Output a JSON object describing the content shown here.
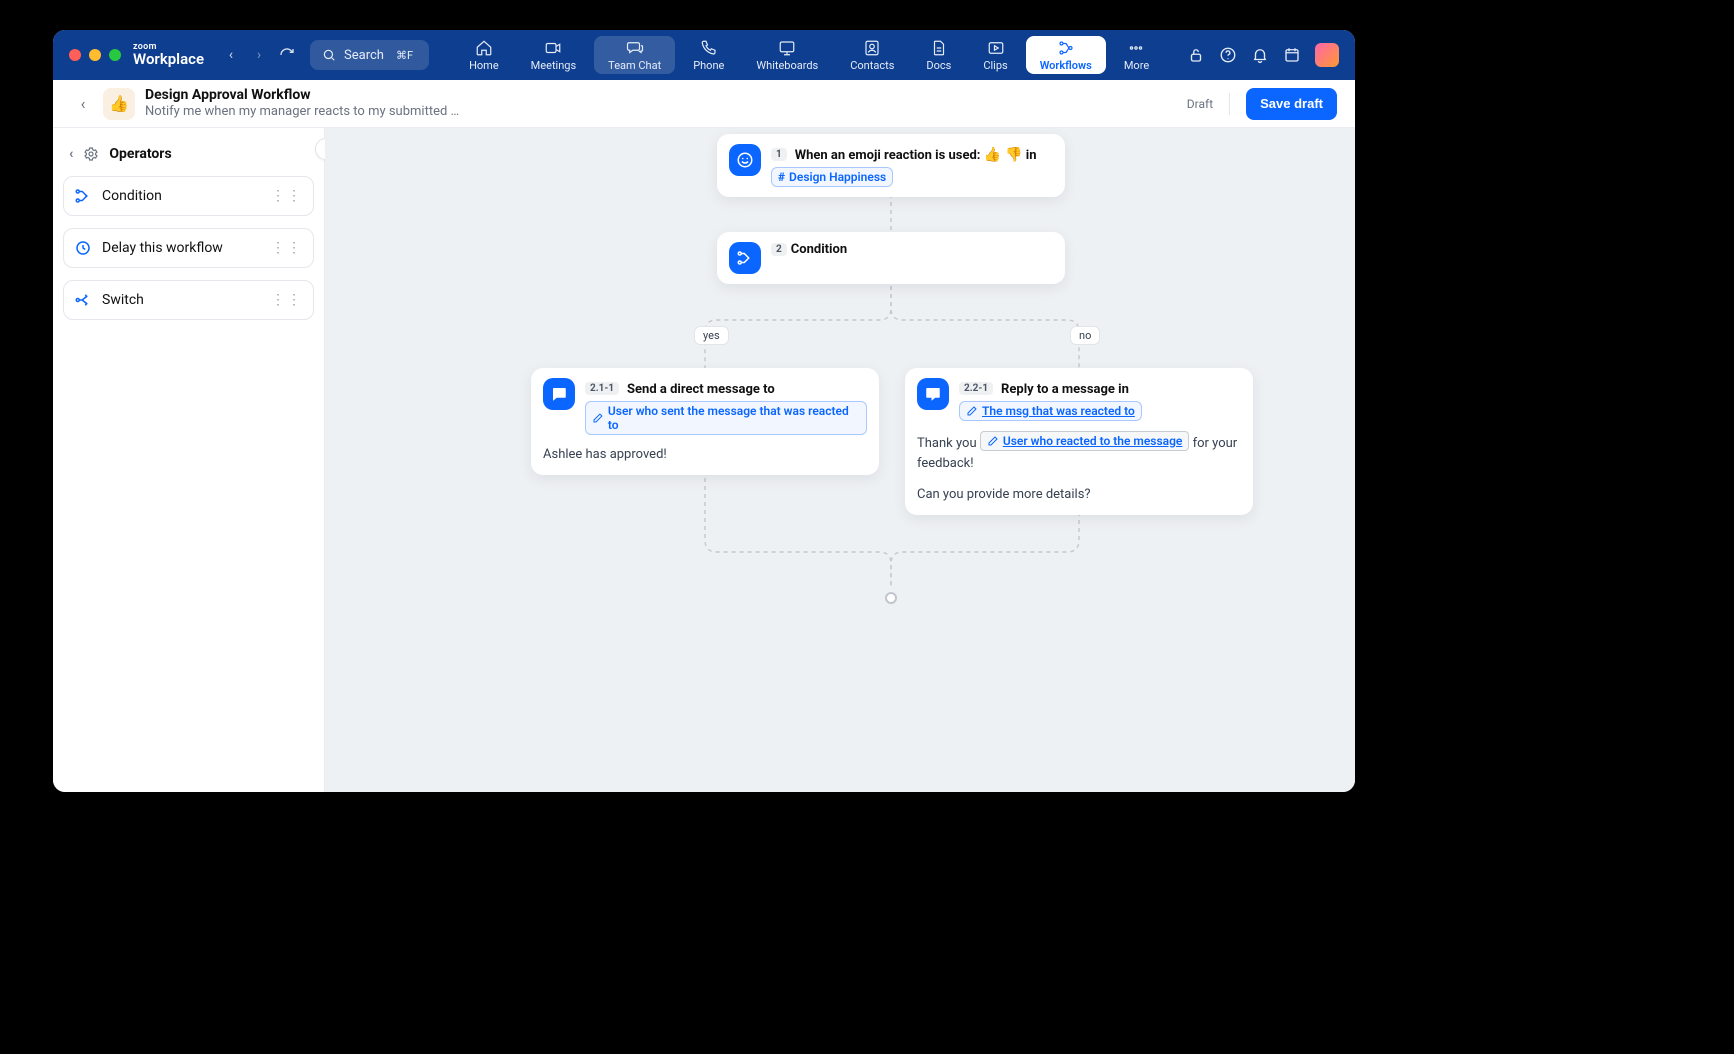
{
  "brand": {
    "small": "zoom",
    "big": "Workplace"
  },
  "search": {
    "placeholder": "Search",
    "shortcut": "⌘F"
  },
  "tabs": {
    "home": "Home",
    "meetings": "Meetings",
    "teamchat": "Team Chat",
    "phone": "Phone",
    "whiteboards": "Whiteboards",
    "contacts": "Contacts",
    "docs": "Docs",
    "clips": "Clips",
    "workflows": "Workflows",
    "more": "More"
  },
  "header": {
    "emoji": "👍",
    "title": "Design Approval Workflow",
    "subtitle": "Notify me when my manager reacts to my submitted …",
    "status": "Draft",
    "save": "Save draft"
  },
  "sidebar": {
    "title": "Operators",
    "items": [
      {
        "label": "Condition"
      },
      {
        "label": "Delay this workflow"
      },
      {
        "label": "Switch"
      }
    ]
  },
  "nodes": {
    "trigger": {
      "step": "1",
      "title_prefix": "When an emoji reaction is used: ",
      "emoji1": "👍",
      "emoji2": "👎",
      "title_suffix": " in",
      "channel": "Design Happiness"
    },
    "condition": {
      "step": "2",
      "title": "Condition"
    },
    "yes": {
      "step": "2.1-1",
      "title": "Send a direct message to",
      "chip": "User who sent the message that was reacted to",
      "body": "Ashlee has approved!"
    },
    "no": {
      "step": "2.2-1",
      "title": "Reply to a message in",
      "chip": "The msg that was reacted to",
      "body_pre": "Thank you ",
      "body_var": "User who reacted to the message",
      "body_post": " for your feedback!",
      "body2": "Can you provide more details?"
    },
    "branch_yes": "yes",
    "branch_no": "no"
  }
}
